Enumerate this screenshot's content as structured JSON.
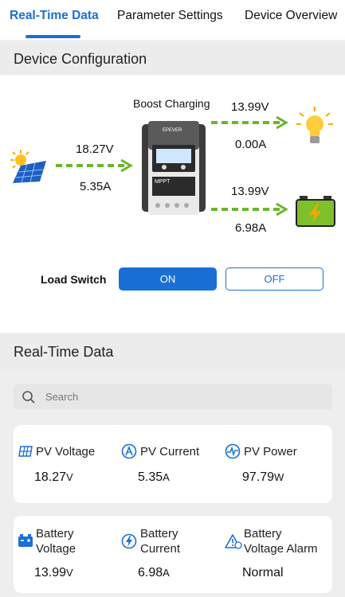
{
  "tabs": [
    {
      "label": "Real-Time Data",
      "active": true
    },
    {
      "label": "Parameter Settings",
      "active": false
    },
    {
      "label": "Device Overview",
      "active": false
    }
  ],
  "device_config": {
    "title": "Device Configuration",
    "charge_mode": "Boost Charging",
    "pv": {
      "voltage": "18.27V",
      "current": "5.35A"
    },
    "load": {
      "voltage": "13.99V",
      "current": "0.00A"
    },
    "battery": {
      "voltage": "13.99V",
      "current": "6.98A"
    },
    "controller_text": {
      "brand": "EPEVER",
      "model": "MPPT"
    },
    "load_switch": {
      "label": "Load Switch",
      "on_label": "ON",
      "off_label": "OFF",
      "state": "ON"
    }
  },
  "realtime": {
    "title": "Real-Time Data",
    "search_placeholder": "Search",
    "cards": [
      [
        {
          "title": "PV Voltage",
          "value": "18.27",
          "unit": "V",
          "icon": "solar-panel-icon"
        },
        {
          "title": "PV Current",
          "value": "5.35",
          "unit": "A",
          "icon": "current-icon"
        },
        {
          "title": "PV Power",
          "value": "97.79",
          "unit": "W",
          "icon": "power-icon"
        }
      ],
      [
        {
          "title_l1": "Battery",
          "title_l2": "Voltage",
          "value": "13.99",
          "unit": "V",
          "icon": "battery-icon"
        },
        {
          "title_l1": "Battery",
          "title_l2": "Current",
          "value": "6.98",
          "unit": "A",
          "icon": "lightning-icon"
        },
        {
          "title_l1": "Battery",
          "title_l2": "Voltage Alarm",
          "value": "Normal",
          "unit": "",
          "icon": "alarm-icon"
        }
      ]
    ]
  },
  "colors": {
    "accent": "#1a6fd6",
    "arrow": "#6bb62a",
    "battery": "#7ec02b"
  }
}
